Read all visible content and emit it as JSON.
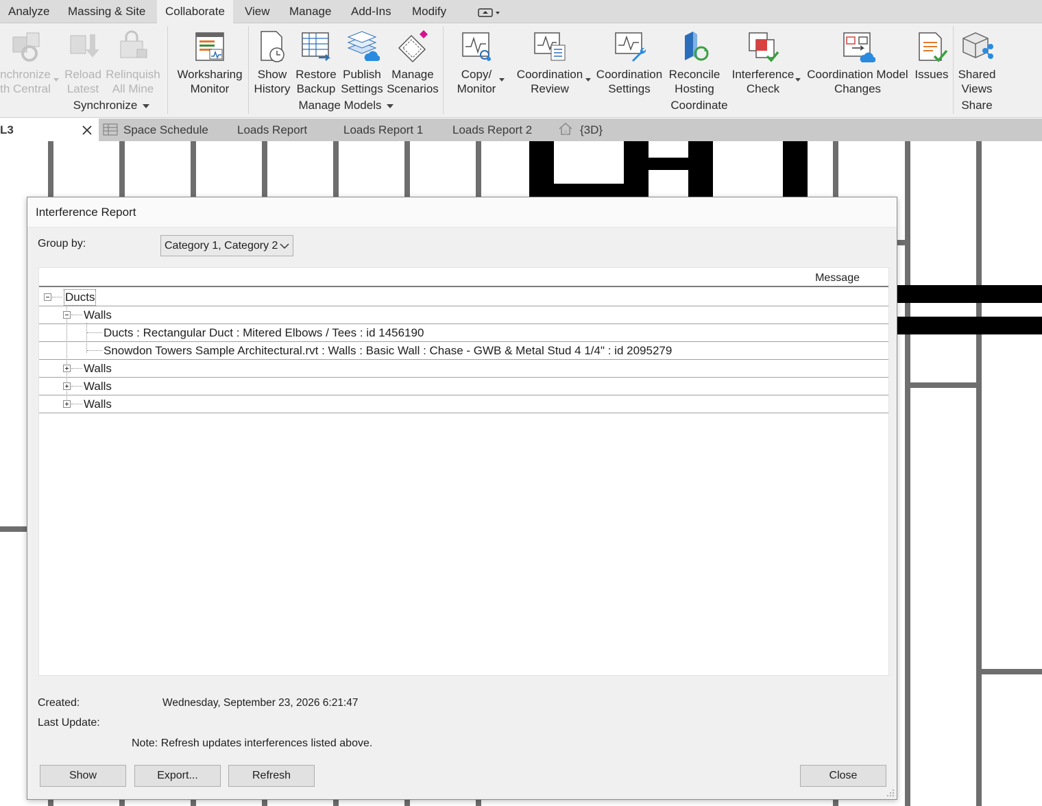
{
  "menubar": {
    "items": [
      "Analyze",
      "Massing & Site",
      "Collaborate",
      "View",
      "Manage",
      "Add-Ins",
      "Modify"
    ],
    "active": "Collaborate"
  },
  "ribbon": {
    "synchronize": {
      "buttons": [
        {
          "label": "nchronize\nth Central",
          "enabled": false
        },
        {
          "label": "Reload\nLatest",
          "enabled": false
        },
        {
          "label": "Relinquish\nAll Mine",
          "enabled": false
        }
      ],
      "group_label": "Synchronize"
    },
    "worksharing_monitor": {
      "label": "Worksharing\nMonitor"
    },
    "manage_models": {
      "buttons": [
        {
          "label": "Show\nHistory"
        },
        {
          "label": "Restore\nBackup"
        },
        {
          "label": "Publish\nSettings"
        },
        {
          "label": "Manage\nScenarios"
        }
      ],
      "group_label": "Manage Models"
    },
    "coordinate": {
      "buttons": [
        {
          "label": "Copy/\nMonitor"
        },
        {
          "label": "Coordination\nReview"
        },
        {
          "label": "Coordination\nSettings"
        },
        {
          "label": "Reconcile\nHosting"
        },
        {
          "label": "Interference\nCheck"
        },
        {
          "label": "Coordination Model\nChanges"
        },
        {
          "label": "Issues"
        }
      ],
      "group_label": "Coordinate"
    },
    "share": {
      "buttons": [
        {
          "label": "Shared\nViews"
        }
      ],
      "group_label": "Share"
    }
  },
  "tabs": {
    "active_label": "L3",
    "items": [
      "Space Schedule",
      "Loads Report",
      "Loads Report 1",
      "Loads Report 2",
      "{3D}"
    ]
  },
  "dialog": {
    "title": "Interference Report",
    "group_by_label": "Group by:",
    "group_by_value": "Category 1, Category 2",
    "column_header": "Message",
    "tree": {
      "root": "Ducts",
      "groups": [
        {
          "label": "Walls",
          "expanded": true,
          "children": [
            "Ducts : Rectangular Duct : Mitered Elbows / Tees : id 1456190",
            "Snowdon Towers Sample Architectural.rvt : Walls : Basic Wall : Chase - GWB & Metal Stud 4 1/4\" : id 2095279"
          ]
        },
        {
          "label": "Walls",
          "expanded": false
        },
        {
          "label": "Walls",
          "expanded": false
        },
        {
          "label": "Walls",
          "expanded": false
        }
      ]
    },
    "created_label": "Created:",
    "created_value": "Wednesday, September 23, 2026 6:21:47",
    "last_update_label": "Last Update:",
    "last_update_value": "",
    "note": "Note: Refresh updates interferences listed above.",
    "buttons": {
      "show": "Show",
      "export": "Export...",
      "refresh": "Refresh",
      "close": "Close"
    }
  }
}
